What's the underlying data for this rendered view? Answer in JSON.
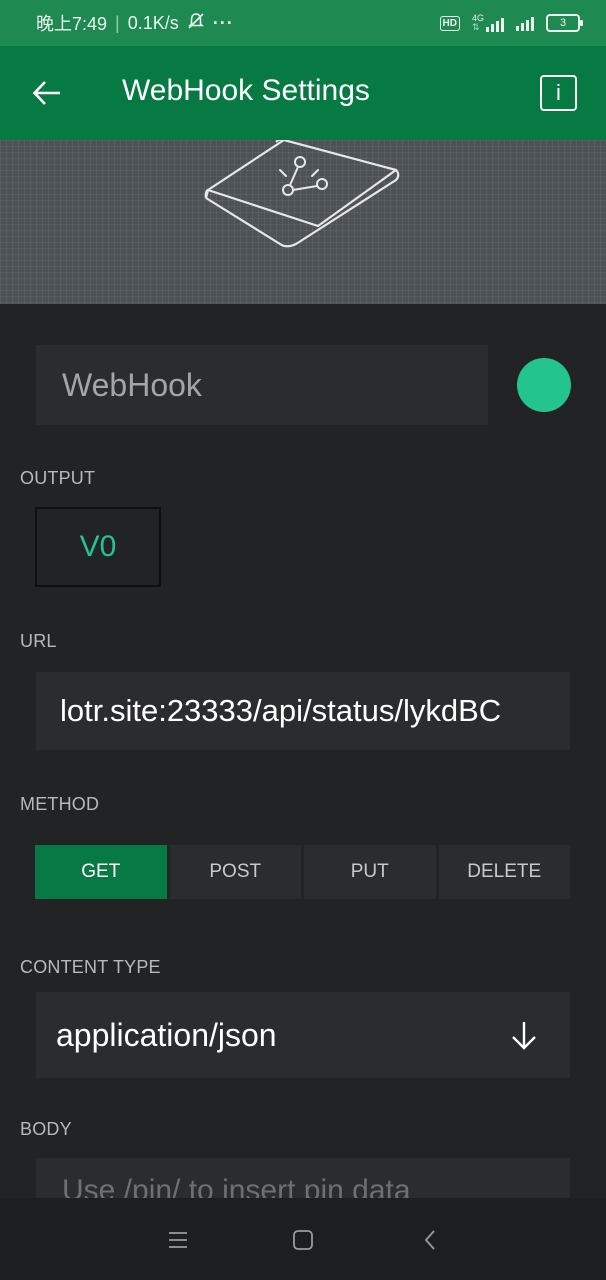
{
  "status_bar": {
    "time": "晚上7:49",
    "speed": "0.1K/s",
    "more": "···",
    "hd": "HD",
    "network": "4G",
    "battery": "3"
  },
  "app_bar": {
    "title": "WebHook Settings",
    "info_label": "i"
  },
  "widget": {
    "name": "WebHook",
    "color": "#23C48E"
  },
  "output": {
    "label": "OUTPUT",
    "pin": "V0"
  },
  "url": {
    "label": "URL",
    "value": "lotr.site:23333/api/status/lykdBC"
  },
  "method": {
    "label": "METHOD",
    "options": [
      "GET",
      "POST",
      "PUT",
      "DELETE"
    ],
    "selected": "GET"
  },
  "content_type": {
    "label": "CONTENT TYPE",
    "value": "application/json"
  },
  "body": {
    "label": "BODY",
    "placeholder": "Use /pin/ to insert pin data"
  },
  "colors": {
    "status_bar": "#1E8A52",
    "app_bar": "#077A43",
    "accent": "#23C48E",
    "background": "#222324",
    "field": "#2B2C2E"
  },
  "icons": {
    "back": "arrow-left-icon",
    "info": "info-icon",
    "hero": "webhook-widget-icon",
    "dropdown": "arrow-down-icon",
    "nav_menu": "menu-icon",
    "nav_home": "home-square-icon",
    "nav_back": "chevron-left-icon"
  }
}
